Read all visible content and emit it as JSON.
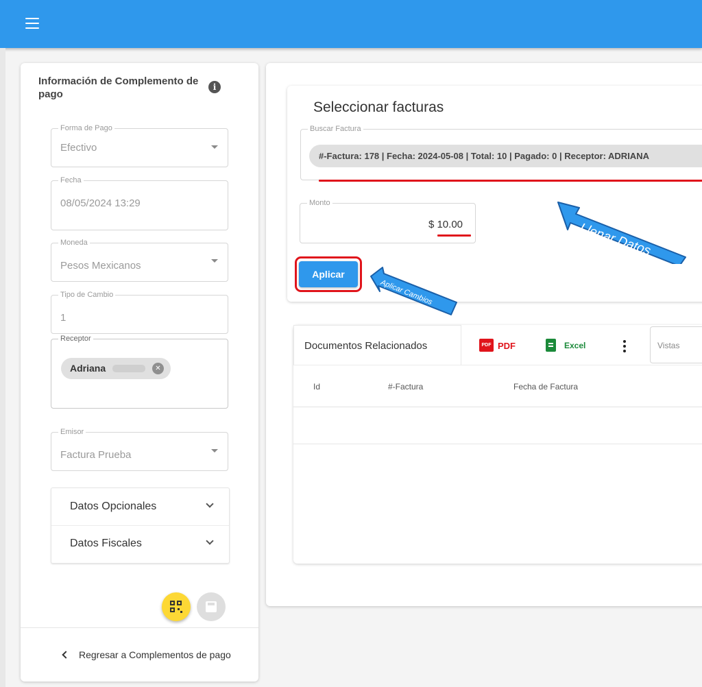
{
  "appbar": {
    "menu_icon": "hamburger-menu-icon",
    "color": "#2f98ec"
  },
  "left_panel": {
    "title": "Información de Complemento de pago",
    "info_icon": "info-icon",
    "fields": {
      "forma_pago": {
        "label": "Forma de Pago",
        "value": "Efectivo"
      },
      "fecha": {
        "label": "Fecha",
        "value": "08/05/2024 13:29"
      },
      "moneda": {
        "label": "Moneda",
        "value": "Pesos Mexicanos"
      },
      "tipo_cambio": {
        "label": "Tipo de Cambio",
        "value": "1"
      },
      "receptor": {
        "label": "Receptor",
        "chip": "Adriana"
      },
      "emisor": {
        "label": "Emisor",
        "value": "Factura Prueba"
      }
    },
    "expansion": [
      {
        "label": "Datos Opcionales"
      },
      {
        "label": "Datos Fiscales"
      }
    ],
    "back_link": "Regresar a Complementos de pago"
  },
  "select_card": {
    "title": "Seleccionar facturas",
    "search_label": "Buscar Factura",
    "search_chip": "#-Factura: 178 | Fecha: 2024-05-08 | Total: 10 | Pagado: 0 | Receptor: ADRIANA",
    "monto_label": "Monto",
    "monto_value": "$ 10.00",
    "apply_label": "Aplicar"
  },
  "annotations": {
    "fill": "Llenar Datos",
    "apply": "Aplicar Cambios",
    "highlight_color": "#e0141b"
  },
  "docs": {
    "tab_label": "Documentos Relacionados",
    "pdf_label": "PDF",
    "excel_label": "Excel",
    "vistas_label": "Vistas",
    "columns": [
      "Id",
      "#-Factura",
      "Fecha de Factura"
    ]
  }
}
